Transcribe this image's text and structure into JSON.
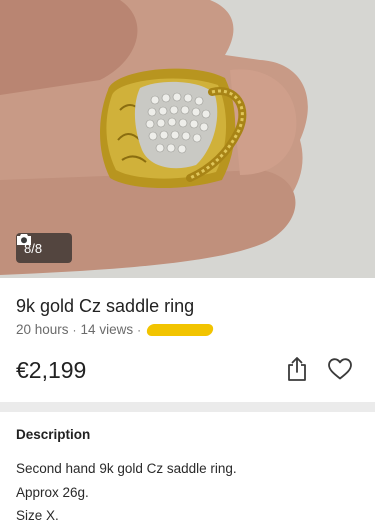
{
  "photo": {
    "description_icon": "camera-icon",
    "counter": "8/8"
  },
  "listing": {
    "title": "9k gold Cz saddle ring",
    "posted": "20 hours",
    "separator": "·",
    "views": "14 views",
    "price": "€2,199"
  },
  "actions": {
    "share_icon": "share-icon",
    "favorite_icon": "heart-icon"
  },
  "description": {
    "heading": "Description",
    "lines": [
      "Second hand 9k gold Cz saddle ring.",
      "Approx 26g.",
      "Size X."
    ]
  },
  "colors": {
    "redaction": "#f2c400",
    "gold": "#b8951f",
    "divider": "#ebebeb"
  }
}
